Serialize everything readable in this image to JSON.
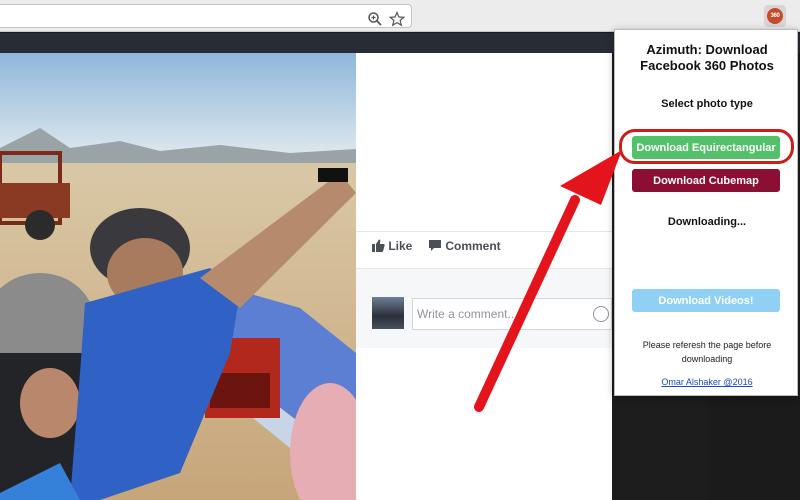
{
  "browser": {
    "extension_badge": "360",
    "icons": [
      "zoom-icon",
      "bookmark-star-icon"
    ]
  },
  "post": {
    "like_label": "Like",
    "comment_label": "Comment",
    "comment_placeholder": "Write a comment..."
  },
  "popup": {
    "title": "Azimuth: Download Facebook 360 Photos",
    "select_label": "Select photo type",
    "equirect_label": "Download Equirectangular",
    "cubemap_label": "Download Cubemap",
    "status": "Downloading...",
    "videos_label": "Download Videos!",
    "note": "Please referesh the page before downloading",
    "credit": "Omar Alshaker @2016"
  },
  "colors": {
    "equirect_button": "#53c16a",
    "cubemap_button": "#8a0f33",
    "videos_button": "#8fd0f4",
    "annotation_red": "#e3141b"
  }
}
